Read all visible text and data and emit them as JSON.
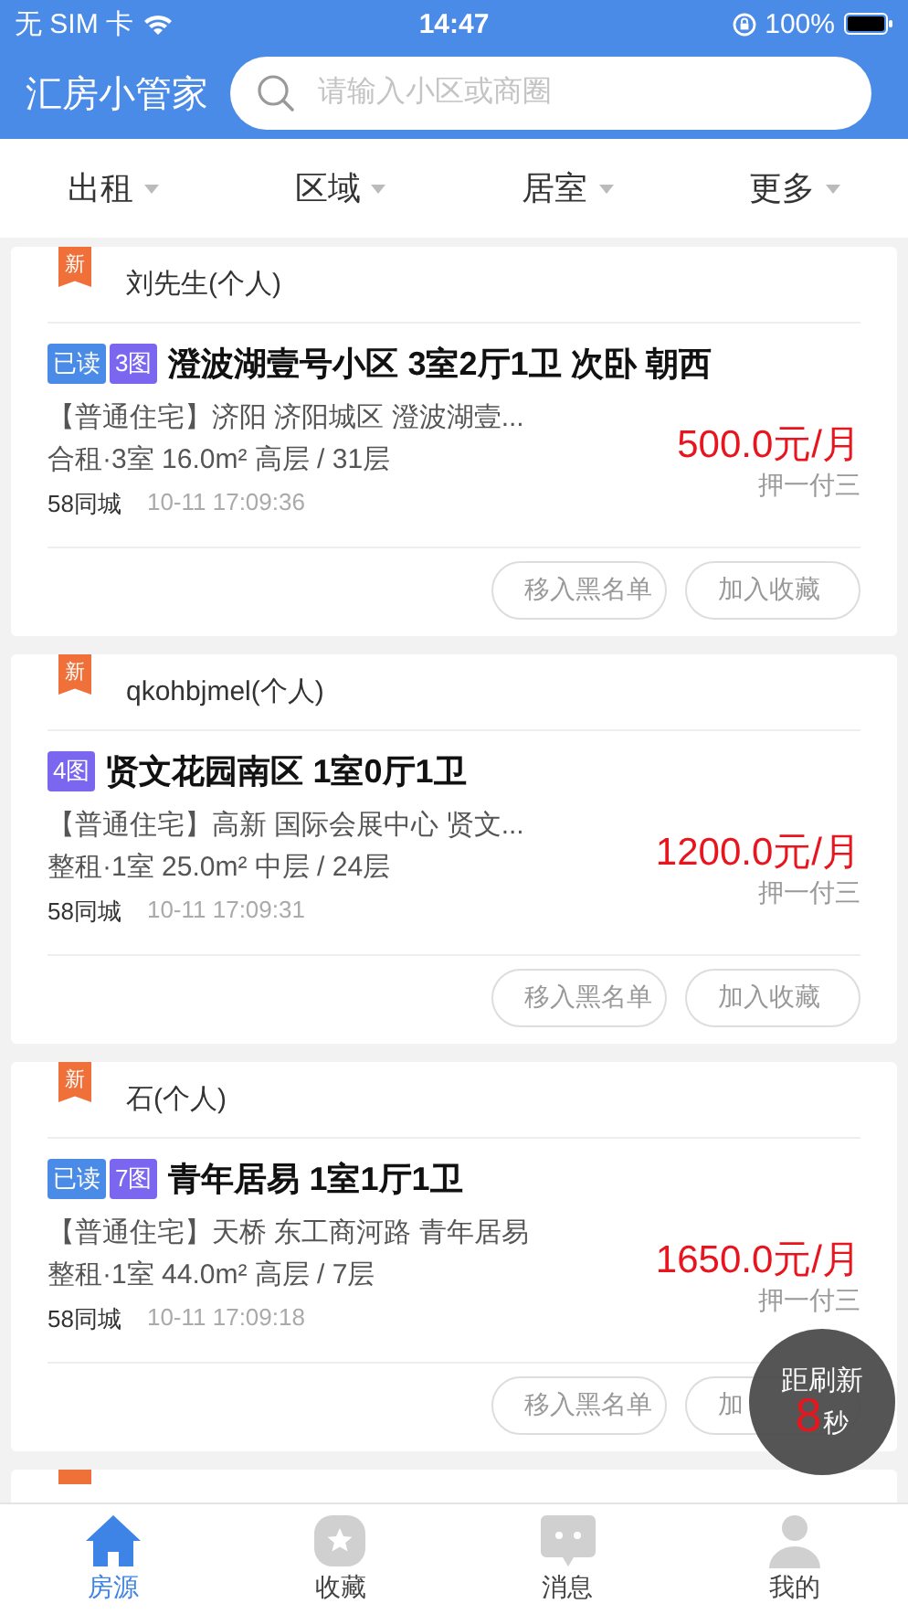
{
  "status_bar": {
    "carrier": "无 SIM 卡",
    "time": "14:47",
    "battery": "100%"
  },
  "header": {
    "title": "汇房小管家",
    "search": {
      "placeholder": "请输入小区或商圈"
    }
  },
  "filters": [
    {
      "label": "出租"
    },
    {
      "label": "区域"
    },
    {
      "label": "居室"
    },
    {
      "label": "更多"
    }
  ],
  "listings": [
    {
      "new_badge": "新",
      "owner": "刘先生(个人)",
      "read": true,
      "read_label": "已读",
      "photos": "3图",
      "title": "澄波湖壹号小区 3室2厅1卫 次卧 朝西",
      "address": "【普通住宅】济阳 济阳城区 澄波湖壹...",
      "details": "合租·3室 16.0m² 高层 / 31层",
      "source": "58同城",
      "time": "10-11 17:09:36",
      "price": "500.0元/月",
      "deposit": "押一付三",
      "actions": [
        "移入黑名单",
        "加入收藏"
      ]
    },
    {
      "new_badge": "新",
      "owner": "qkohbjmel(个人)",
      "read": false,
      "photos": "4图",
      "title": "贤文花园南区 1室0厅1卫",
      "address": "【普通住宅】高新 国际会展中心 贤文...",
      "details": "整租·1室 25.0m² 中层 / 24层",
      "source": "58同城",
      "time": "10-11 17:09:31",
      "price": "1200.0元/月",
      "deposit": "押一付三",
      "actions": [
        "移入黑名单",
        "加入收藏"
      ]
    },
    {
      "new_badge": "新",
      "owner": "石(个人)",
      "read": true,
      "read_label": "已读",
      "photos": "7图",
      "title": "青年居易 1室1厅1卫",
      "address": "【普通住宅】天桥 东工商河路 青年居易",
      "details": "整租·1室 44.0m² 高层 / 7层",
      "source": "58同城",
      "time": "10-11 17:09:18",
      "price": "1650.0元/月",
      "deposit": "押一付三",
      "actions": [
        "移入黑名单",
        "加"
      ]
    }
  ],
  "refresh_timer": {
    "label": "距刷新",
    "seconds": "8",
    "unit": "秒"
  },
  "tab_bar": [
    {
      "label": "房源",
      "selected": true
    },
    {
      "label": "收藏",
      "selected": false
    },
    {
      "label": "消息",
      "selected": false
    },
    {
      "label": "我的",
      "selected": false
    }
  ]
}
